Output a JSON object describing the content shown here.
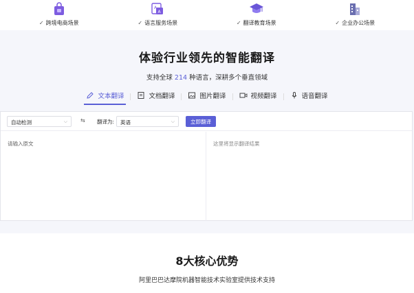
{
  "scenarios": [
    {
      "label": "跨境电商场景",
      "icon": "shopping-bag-icon",
      "color": "#7d5ce0"
    },
    {
      "label": "语言服务场景",
      "icon": "language-doc-icon",
      "color": "#7d5ce0"
    },
    {
      "label": "翻译教育场景",
      "icon": "graduation-cap-icon",
      "color": "#6a56d8"
    },
    {
      "label": "企业办公场景",
      "icon": "office-building-icon",
      "color": "#6b6fb0"
    }
  ],
  "check_glyph": "✓",
  "hero": {
    "title": "体验行业领先的智能翻译",
    "sub_before": "支持全球",
    "sub_num": "214",
    "sub_after": "种语言，深耕多个垂直领域"
  },
  "tabs": [
    {
      "label": "文本翻译",
      "icon": "pencil-icon",
      "active": true
    },
    {
      "label": "文档翻译",
      "icon": "document-icon",
      "active": false
    },
    {
      "label": "图片翻译",
      "icon": "image-icon",
      "active": false
    },
    {
      "label": "视频翻译",
      "icon": "video-icon",
      "active": false
    },
    {
      "label": "语音翻译",
      "icon": "microphone-icon",
      "active": false
    }
  ],
  "translator": {
    "source_lang": "自动检测",
    "swap_symbol": "⇆",
    "target_label": "翻译为:",
    "target_lang": "英语",
    "translate_button": "立即翻译",
    "input_placeholder": "请输入原文",
    "output_placeholder": "这里将显示翻译结果"
  },
  "advantages": {
    "title": "8大核心优势",
    "subtitle": "阿里巴巴达摩院机器智能技术实验室提供技术支持"
  },
  "colors": {
    "accent": "#5a5fd6",
    "background": "#f5f6fb"
  }
}
